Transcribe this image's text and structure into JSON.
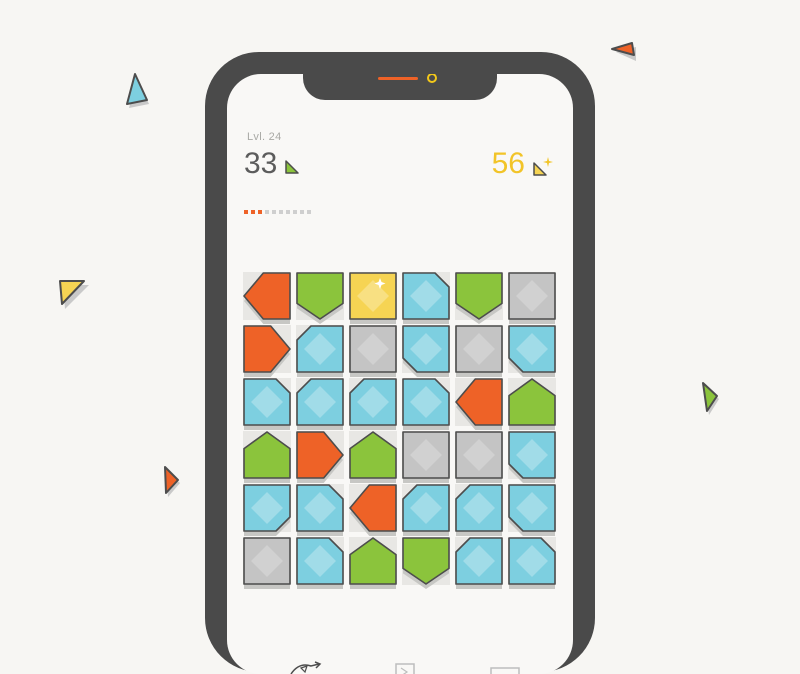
{
  "game": {
    "level_label": "Lvl. 24",
    "moves_left": "33",
    "stars": "56",
    "progress": {
      "done": 3,
      "total": 10
    }
  },
  "colors": {
    "orange": "#ee6227",
    "green": "#8bc43c",
    "yellow": "#f6d453",
    "blue": "#7dcfe0",
    "gray": "#c4c4c4",
    "frame": "#4a4a4a",
    "outline": "#4d4d4d",
    "background": "#f7f6f3"
  },
  "board": {
    "rows": 6,
    "cols": 6,
    "tiles": [
      [
        {
          "color": "orange",
          "shape": "arrow-left"
        },
        {
          "color": "green",
          "shape": "arrow-down"
        },
        {
          "color": "yellow",
          "shape": "square"
        },
        {
          "color": "blue",
          "shape": "cut-tr"
        },
        {
          "color": "green",
          "shape": "arrow-down"
        },
        {
          "color": "gray",
          "shape": "square"
        }
      ],
      [
        {
          "color": "orange",
          "shape": "arrow-right"
        },
        {
          "color": "blue",
          "shape": "cut-tl"
        },
        {
          "color": "gray",
          "shape": "square"
        },
        {
          "color": "blue",
          "shape": "cut-bl"
        },
        {
          "color": "gray",
          "shape": "square"
        },
        {
          "color": "blue",
          "shape": "cut-bl"
        }
      ],
      [
        {
          "color": "blue",
          "shape": "cut-tr"
        },
        {
          "color": "blue",
          "shape": "cut-tl"
        },
        {
          "color": "blue",
          "shape": "cut-tl"
        },
        {
          "color": "blue",
          "shape": "cut-tr"
        },
        {
          "color": "orange",
          "shape": "arrow-left"
        },
        {
          "color": "green",
          "shape": "arrow-up"
        }
      ],
      [
        {
          "color": "green",
          "shape": "arrow-up"
        },
        {
          "color": "orange",
          "shape": "arrow-right"
        },
        {
          "color": "green",
          "shape": "arrow-up"
        },
        {
          "color": "gray",
          "shape": "square"
        },
        {
          "color": "gray",
          "shape": "square"
        },
        {
          "color": "blue",
          "shape": "cut-bl"
        }
      ],
      [
        {
          "color": "blue",
          "shape": "cut-br"
        },
        {
          "color": "blue",
          "shape": "cut-tr"
        },
        {
          "color": "orange",
          "shape": "arrow-left"
        },
        {
          "color": "blue",
          "shape": "cut-tl"
        },
        {
          "color": "blue",
          "shape": "cut-tl"
        },
        {
          "color": "blue",
          "shape": "cut-bl"
        }
      ],
      [
        {
          "color": "gray",
          "shape": "square"
        },
        {
          "color": "blue",
          "shape": "cut-tr"
        },
        {
          "color": "green",
          "shape": "arrow-up"
        },
        {
          "color": "green",
          "shape": "arrow-down"
        },
        {
          "color": "blue",
          "shape": "cut-tl"
        },
        {
          "color": "blue",
          "shape": "cut-tr"
        }
      ]
    ]
  },
  "icons": {
    "moves": "triangle-moves-icon",
    "stars": "triangle-star-icon",
    "bottom": [
      "undo-icon",
      "hint-icon",
      "menu-icon"
    ],
    "decorations": [
      "blue-triangle-icon",
      "orange-triangle-icon",
      "yellow-triangle-icon",
      "green-triangle-icon",
      "orange-small-triangle-icon"
    ]
  }
}
